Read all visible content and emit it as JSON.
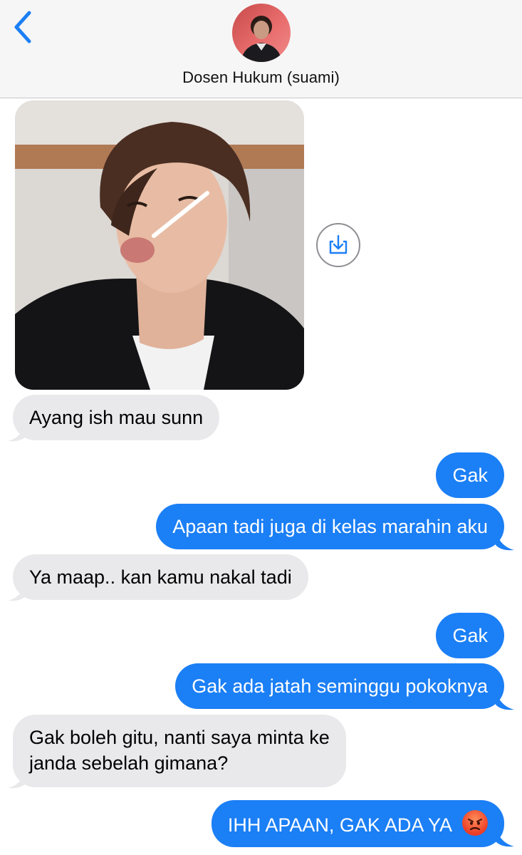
{
  "header": {
    "contact_name": "Dosen Hukum (suami)",
    "back_icon": "chevron-left-icon",
    "accent": "#1b7ff5"
  },
  "messages": [
    {
      "type": "image",
      "from": "contact",
      "description_icon": "photo-attachment"
    },
    {
      "type": "text",
      "from": "contact",
      "text": "Ayang ish mau sunn"
    },
    {
      "type": "text",
      "from": "me",
      "text": "Gak"
    },
    {
      "type": "text",
      "from": "me",
      "text": "Apaan tadi juga di kelas marahin aku"
    },
    {
      "type": "text",
      "from": "contact",
      "text": "Ya maap.. kan kamu nakal tadi"
    },
    {
      "type": "text",
      "from": "me",
      "text": "Gak"
    },
    {
      "type": "text",
      "from": "me",
      "text": "Gak ada jatah seminggu pokoknya"
    },
    {
      "type": "text",
      "from": "contact",
      "lines": [
        "Gak boleh gitu, nanti saya minta ke",
        "janda sebelah gimana?"
      ]
    },
    {
      "type": "text",
      "from": "me",
      "text": "IHH APAAN, GAK ADA YA",
      "emoji": "angry-face"
    }
  ],
  "colors": {
    "incoming_bubble": "#e9e9eb",
    "outgoing_bubble": "#1b7ff5",
    "header_bg": "#f6f6f6"
  }
}
